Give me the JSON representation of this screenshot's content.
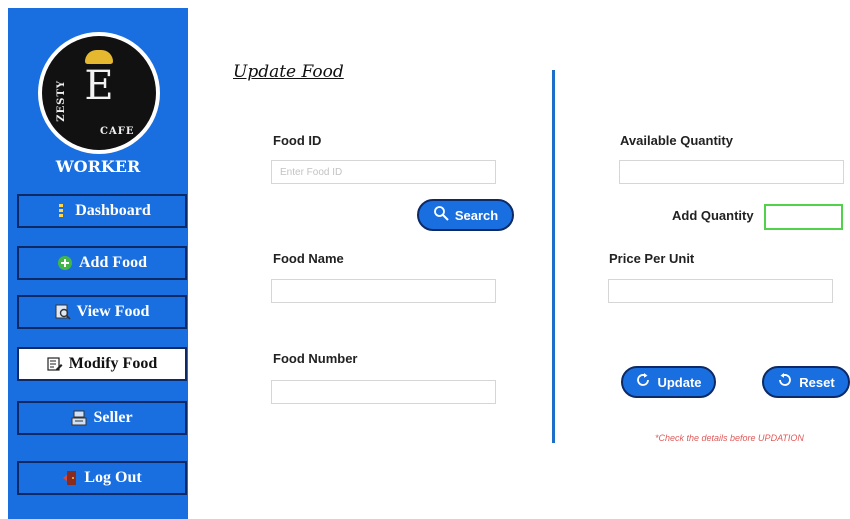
{
  "sidebar": {
    "logo": {
      "brand": "ZESTY CAFE",
      "letter": "E"
    },
    "role": "WORKER",
    "items": [
      {
        "label": "Dashboard",
        "icon": "dashboard-icon"
      },
      {
        "label": "Add Food",
        "icon": "plus-circle-icon"
      },
      {
        "label": "View Food",
        "icon": "magnifier-document-icon"
      },
      {
        "label": "Modify Food",
        "icon": "edit-document-icon",
        "active": true
      },
      {
        "label": "Seller",
        "icon": "cash-register-icon"
      },
      {
        "label": "Log Out",
        "icon": "exit-door-icon"
      }
    ]
  },
  "form": {
    "title": "Update Food",
    "food_id": {
      "label": "Food ID",
      "placeholder": "Enter Food ID",
      "value": ""
    },
    "search_button": "Search",
    "food_name": {
      "label": "Food Name",
      "value": ""
    },
    "food_number": {
      "label": "Food Number",
      "value": ""
    },
    "available_quantity": {
      "label": "Available Quantity",
      "value": ""
    },
    "add_quantity": {
      "label": "Add Quantity",
      "value": ""
    },
    "price_per_unit": {
      "label": "Price Per Unit",
      "value": ""
    },
    "update_button": "Update",
    "reset_button": "Reset",
    "note": "*Check the details before UPDATION"
  },
  "colors": {
    "sidebar": "#1a6fe0",
    "button_border": "#0d2a66",
    "divider": "#1b6fc9",
    "add_quantity_border": "#52d14a",
    "note": "#e05a5a"
  }
}
